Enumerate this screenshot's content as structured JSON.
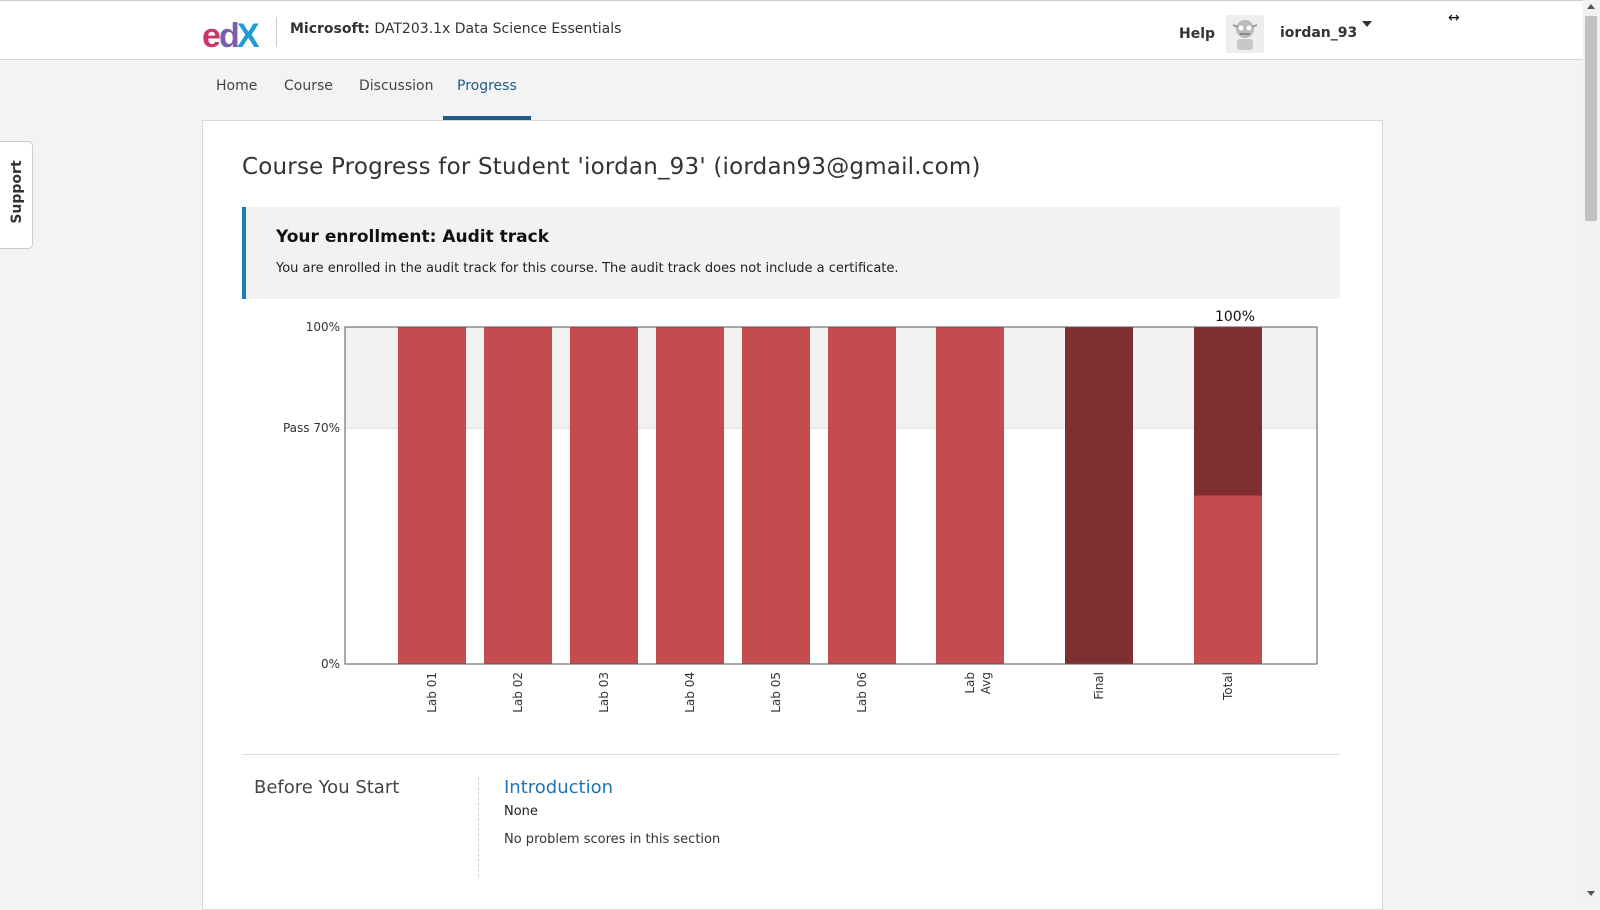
{
  "header": {
    "logo_text": "edX",
    "course_org": "Microsoft:",
    "course_name": "DAT203.1x Data Science Essentials",
    "help_label": "Help",
    "username": "iordan_93",
    "resize_cursor_glyph": "↔"
  },
  "tabs": [
    {
      "label": "Home",
      "active": false
    },
    {
      "label": "Course",
      "active": false
    },
    {
      "label": "Discussion",
      "active": false
    },
    {
      "label": "Progress",
      "active": true
    }
  ],
  "support_label": "Support",
  "page": {
    "heading": "Course Progress for Student 'iordan_93' (iordan93@gmail.com)",
    "enrollment_title": "Your enrollment: Audit track",
    "enrollment_message": "You are enrolled in the audit track for this course. The audit track does not include a certificate."
  },
  "chart_data": {
    "type": "bar",
    "categories": [
      "Lab 01",
      "Lab 02",
      "Lab 03",
      "Lab 04",
      "Lab 05",
      "Lab 06",
      "Lab Avg",
      "Final",
      "Total"
    ],
    "series": [
      {
        "values": [
          100,
          100,
          100,
          100,
          100,
          100,
          100,
          0,
          50
        ]
      },
      {
        "values": [
          0,
          0,
          0,
          0,
          0,
          0,
          0,
          100,
          50
        ]
      }
    ],
    "stacked": true,
    "ylim": [
      0,
      100
    ],
    "y_ticks": [
      {
        "value": 0,
        "label": "0%"
      },
      {
        "value": 70,
        "label": "Pass 70%"
      },
      {
        "value": 100,
        "label": "100%"
      }
    ],
    "pass_threshold": 70,
    "total_label": "100%",
    "colors": {
      "lab": "#c44c4e",
      "final": "#7f2e31",
      "pass_band": "#f2f2f2",
      "axis": "#555555"
    }
  },
  "progress": {
    "chapter_title": "Before You Start",
    "section_title": "Introduction",
    "section_score": "None",
    "section_note": "No problem scores in this section"
  }
}
